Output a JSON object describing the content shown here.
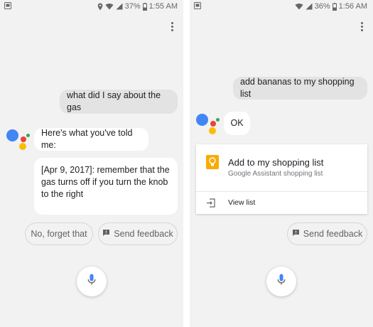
{
  "left": {
    "status": {
      "battery": "37%",
      "time": "1:55 AM"
    },
    "user_query": "what did I say about the gas",
    "assistant_reply": "Here's what you've told me:",
    "note_text": "[Apr 9, 2017]: remember that the gas turns off if you turn the knob to the right",
    "chips": {
      "forget": "No, forget that",
      "feedback": "Send feedback"
    }
  },
  "right": {
    "status": {
      "battery": "36%",
      "time": "1:56 AM"
    },
    "user_query": "add bananas to my shopping list",
    "assistant_reply": "OK",
    "card": {
      "title": "Add to my shopping list",
      "subtitle": "Google Assistant shopping list",
      "action": "View list"
    },
    "chips": {
      "feedback": "Send feedback"
    }
  },
  "icons": {
    "assistant_logo": "google-assistant-logo-icon",
    "mic": "microphone-icon",
    "more": "more-vertical-icon",
    "feedback": "feedback-icon",
    "bulb": "lightbulb-icon",
    "view_list": "open-list-icon"
  },
  "colors": {
    "blue": "#4285f4",
    "red": "#ea4335",
    "yellow": "#fbbc05",
    "green": "#34a853",
    "bulb": "#f9ab00",
    "user_bubble": "#e3e3e3",
    "background": "#f2f2f2"
  }
}
